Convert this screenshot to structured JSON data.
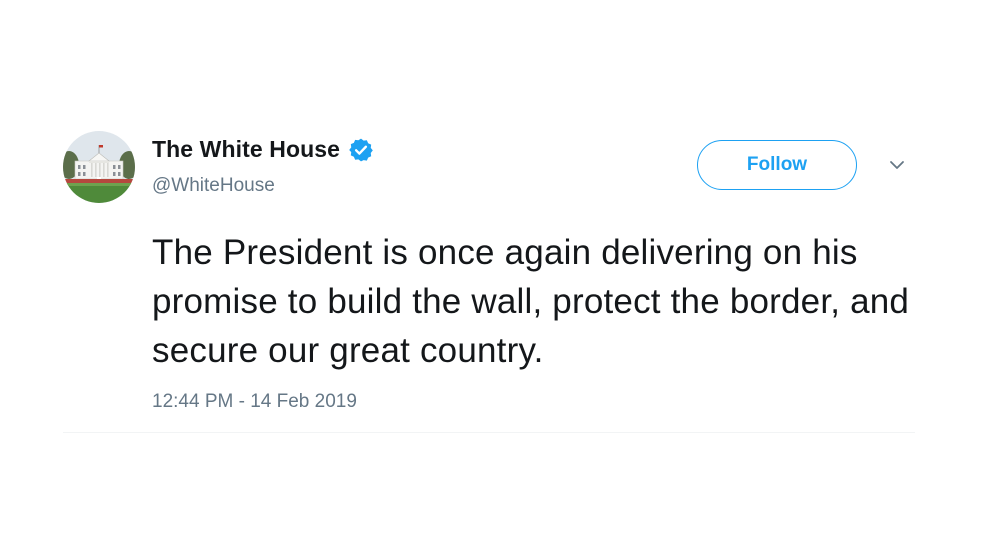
{
  "account": {
    "display_name": "The White House",
    "handle": "@WhiteHouse",
    "verified": true,
    "verified_icon": "verified-badge-icon",
    "avatar_icon": "white-house-avatar"
  },
  "actions": {
    "follow_label": "Follow",
    "more_icon": "chevron-down-icon"
  },
  "tweet": {
    "text": "The President is once again delivering on his promise to build the wall, protect the border, and secure our great country.",
    "timestamp": "12:44 PM - 14 Feb 2019"
  },
  "colors": {
    "accent": "#1da1f2",
    "text": "#14171a",
    "secondary_text": "#657786"
  }
}
